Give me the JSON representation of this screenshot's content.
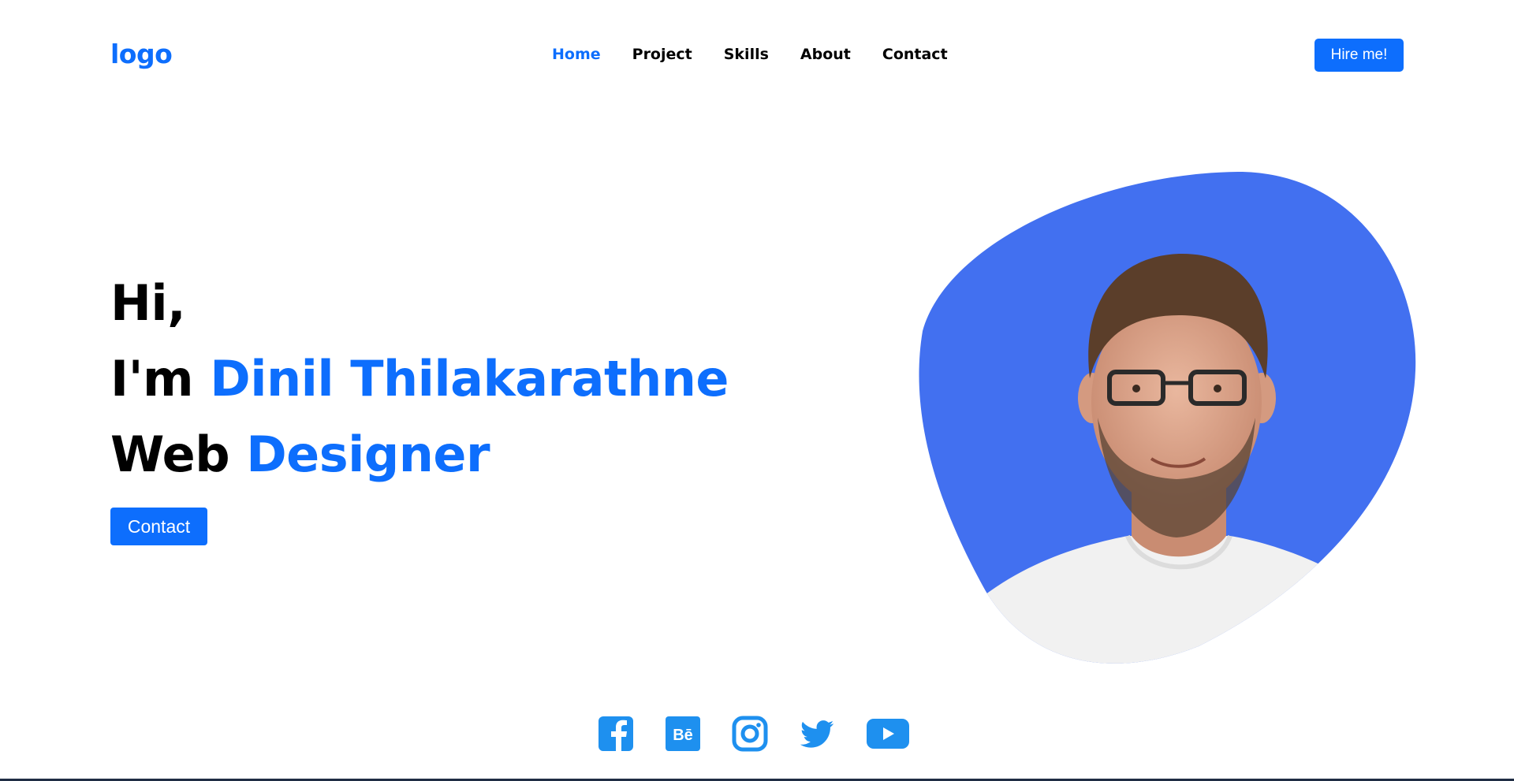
{
  "header": {
    "logo": "logo",
    "nav": [
      "Home",
      "Project",
      "Skills",
      "About",
      "Contact"
    ],
    "active_nav": "Home",
    "hire_label": "Hire me!"
  },
  "hero": {
    "greeting": "Hi,",
    "intro_prefix": "I'm",
    "name": "Dinil Thilakarathne",
    "role_prefix": "Web",
    "role": "Designer",
    "contact_label": "Contact"
  },
  "socials": [
    "facebook-icon",
    "behance-icon",
    "instagram-icon",
    "twitter-icon",
    "youtube-icon"
  ],
  "colors": {
    "accent": "#0d6efd",
    "blob": "#4270f0",
    "social": "#1e90ef",
    "text": "#000000"
  }
}
